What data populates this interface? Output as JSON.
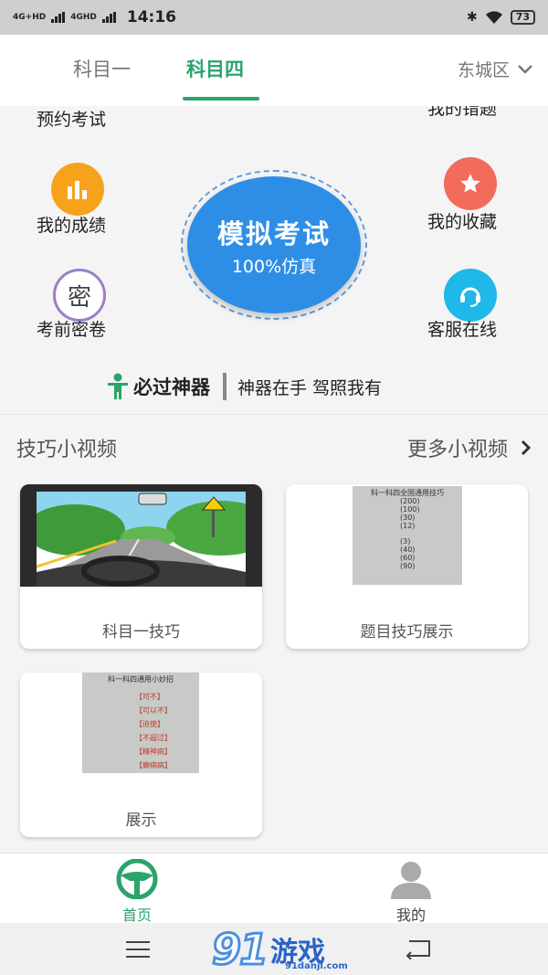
{
  "status_bar": {
    "net1": "4G+HD",
    "net2": "4GHD",
    "time": "14:16",
    "battery": "73"
  },
  "tabs": {
    "items": [
      {
        "label": "科目一",
        "active": false
      },
      {
        "label": "科目四",
        "active": true
      }
    ],
    "district": "东城区"
  },
  "features": {
    "top_left": "预约考试",
    "top_right": "我的错题",
    "scores": "我的成绩",
    "favorites": "我的收藏",
    "secret_paper": "考前密卷",
    "secret_icon_char": "密",
    "service": "客服在线",
    "exam_title": "模拟考试",
    "exam_subtitle": "100%仿真"
  },
  "tagline": {
    "strong": "必过神器",
    "light": "神器在手  驾照我有"
  },
  "videos": {
    "title": "技巧小视频",
    "more": "更多小视频",
    "items": [
      {
        "label": "科目一技巧"
      },
      {
        "label": "题目技巧展示"
      },
      {
        "label": "展示"
      }
    ],
    "thumb2": {
      "heading": "科一科四全国通用技巧",
      "lines": [
        "(200)",
        "(100)",
        "(30)",
        "(12)",
        "(3)",
        "(40)",
        "(60)",
        "(90)"
      ]
    },
    "thumb3": {
      "heading": "科一科四通用小妙招",
      "lines": [
        "【可不】",
        "【可以不】",
        "【迫使】",
        "【不超过】",
        "【精神病】",
        "【癫痫病】"
      ]
    }
  },
  "bottom_nav": {
    "home": "首页",
    "me": "我的"
  },
  "watermark": {
    "logo_num": "91",
    "logo_text": "游戏",
    "site": "91danji.com"
  },
  "colors": {
    "accent": "#2ba36b",
    "exam_blue": "#2e8ee6",
    "scores_orange": "#f7a21b",
    "favorites_red": "#f26b5b",
    "service_cyan": "#1fb8e8",
    "secret_purple": "#9b7fc6"
  }
}
